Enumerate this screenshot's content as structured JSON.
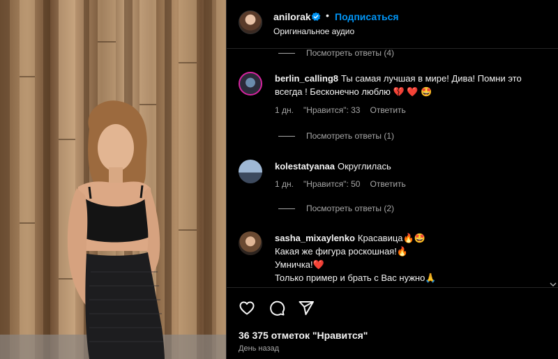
{
  "post": {
    "username": "anilorak",
    "verified_icon": "verified-badge-icon",
    "separator": "•",
    "follow_label": "Подписаться",
    "audio": "Оригинальное аудио"
  },
  "comments": {
    "top_replies": "Посмотреть ответы (4)",
    "items": [
      {
        "username": "berlin_calling8",
        "text": "Ты самая лучшая в мире! Дива! Помни это всегда ! Бесконечно люблю 💔 ❤️ 🤩",
        "time": "1 дн.",
        "likes": "\"Нравится\": 33",
        "reply": "Ответить",
        "replies": "Посмотреть ответы (1)"
      },
      {
        "username": "kolestatyanaa",
        "text": "Округлилась",
        "time": "1 дн.",
        "likes": "\"Нравится\": 50",
        "reply": "Ответить",
        "replies": "Посмотреть ответы (2)"
      },
      {
        "username": "sasha_mixaylenko",
        "line1": "Красавица🔥🤩",
        "line2": "Какая же фигура роскошная!🔥",
        "line3": "Умничка!❤️",
        "line4": "Только пример и брать с Вас нужно🙏"
      }
    ]
  },
  "actions": {
    "like_icon": "heart-icon",
    "comment_icon": "comment-icon",
    "share_icon": "share-icon",
    "likes_count": "36 375 отметок \"Нравится\"",
    "date": "День назад"
  },
  "colors": {
    "background": "#000000",
    "accent": "#0095f6",
    "secondary_text": "#a8a8a8",
    "divider": "#262626"
  }
}
